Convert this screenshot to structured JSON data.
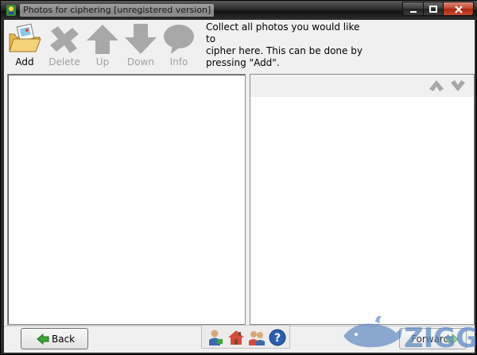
{
  "window": {
    "title": "Photos for ciphering [unregistered version]",
    "controls": [
      "minimize",
      "maximize",
      "close"
    ]
  },
  "toolbar": {
    "add_label": "Add",
    "delete_label": "Delete",
    "up_label": "Up",
    "down_label": "Down",
    "info_label": "Info",
    "instruction_line1": "Collect all photos you would like to",
    "instruction_line2": "cipher here. This can be done by",
    "instruction_line3": "pressing \"Add\"."
  },
  "navigation": {
    "back_label": "Back",
    "forward_label": "Forward"
  },
  "icons": {
    "add": "folder-photo-icon",
    "delete": "delete-x-icon",
    "up": "arrow-up-icon",
    "down": "arrow-down-icon",
    "info": "info-bubble-icon",
    "bottom": [
      "user-key-icon",
      "home-icon",
      "users-icon",
      "help-icon"
    ]
  },
  "watermark": {
    "text": "ZIGG"
  },
  "colors": {
    "disabled_gray": "#a0a0a0",
    "accent_green": "#3aa635",
    "help_blue": "#2a5fb0",
    "watermark_blue": "#5a86c2"
  }
}
